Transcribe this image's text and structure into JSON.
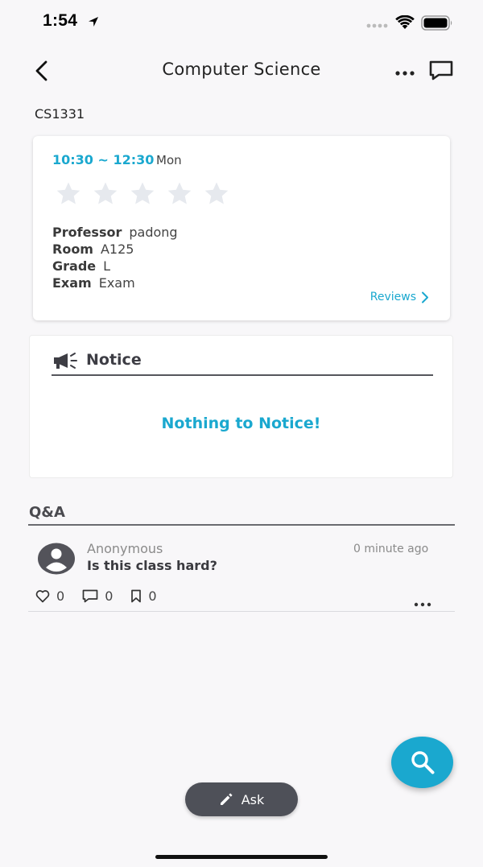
{
  "status_bar": {
    "time": "1:54",
    "icons": [
      "location-arrow-icon",
      "signal-icon",
      "wifi-icon",
      "battery-icon"
    ]
  },
  "nav": {
    "title": "Computer Science",
    "back_icon": "chevron-left-icon",
    "more_icon": "ellipsis-icon",
    "chat_icon": "chat-bubble-icon"
  },
  "course": {
    "code": "CS1331",
    "time": "10:30 ~ 12:30",
    "day": "Mon",
    "rating": 0,
    "rating_max": 5,
    "info": [
      {
        "key": "Professor",
        "value": "padong"
      },
      {
        "key": "Room",
        "value": "A125"
      },
      {
        "key": "Grade",
        "value": "L"
      },
      {
        "key": "Exam",
        "value": "Exam"
      }
    ],
    "reviews_label": "Reviews"
  },
  "notice": {
    "title": "Notice",
    "empty_message": "Nothing to Notice!"
  },
  "qa": {
    "heading": "Q&A",
    "posts": [
      {
        "author": "Anonymous",
        "time": "0 minute ago",
        "title": "Is this class hard?",
        "likes": "0",
        "comments": "0",
        "bookmarks": "0"
      }
    ]
  },
  "actions": {
    "ask_label": "Ask",
    "search_icon": "search-icon"
  },
  "colors": {
    "accent": "#1aa8cf",
    "dark_button": "#4e5058",
    "background": "#f8f7f9"
  }
}
